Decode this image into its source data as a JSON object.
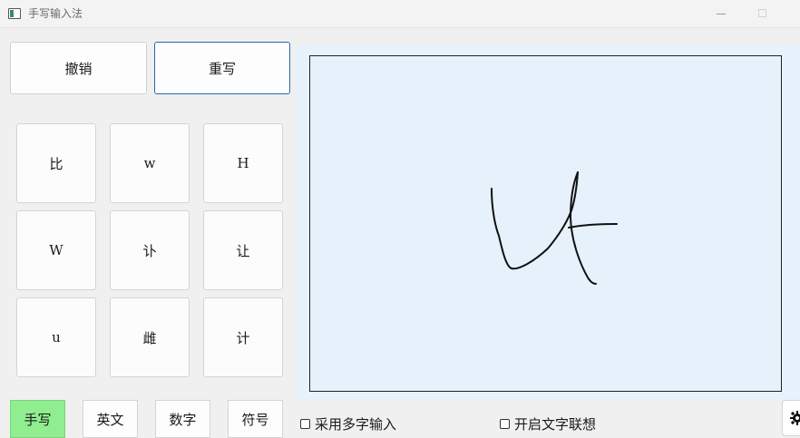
{
  "window": {
    "title": "手写输入法",
    "controls": [
      "minimize",
      "maximize",
      "close"
    ]
  },
  "toolbar": {
    "undo_label": "撤销",
    "rewrite_label": "重写"
  },
  "candidates": [
    "比",
    "w",
    "H",
    "W",
    "讣",
    "让",
    "u",
    "雌",
    "计"
  ],
  "modes": {
    "items": [
      {
        "label": "手写",
        "active": true
      },
      {
        "label": "英文",
        "active": false
      },
      {
        "label": "数字",
        "active": false
      },
      {
        "label": "符号",
        "active": false
      }
    ],
    "active_color": "#90ee90"
  },
  "options": {
    "multi_char_label": "采用多字输入",
    "multi_char_checked": false,
    "association_label": "开启文字联想",
    "association_checked": false
  },
  "settings": {
    "icon": "gear-icon"
  },
  "colors": {
    "canvas_bg": "#e6f1fc",
    "canvas_border": "#222222",
    "stroke": "#111111",
    "rewrite_border": "#2b6aa3"
  }
}
